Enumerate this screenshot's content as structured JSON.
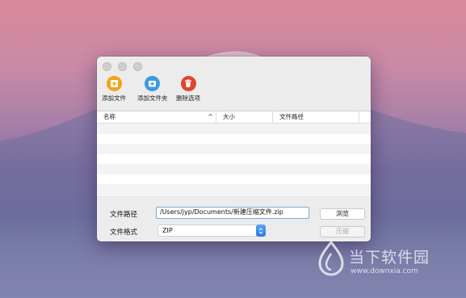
{
  "toolbar": {
    "add_file_label": "添加文件",
    "add_folder_label": "添加文件夹",
    "delete_label": "删除选项"
  },
  "table": {
    "columns": [
      "名称",
      "大小",
      "文件路径"
    ],
    "sort_indicator": "^"
  },
  "form": {
    "path_label": "文件路径",
    "path_value": "/Users/jyp/Documents/新建压缩文件.zip",
    "format_label": "文件格式",
    "format_value": "ZIP",
    "browse_label": "浏览",
    "compress_label": "压缩"
  },
  "watermark": {
    "name": "当下软件园",
    "url": "www.downxia.com"
  },
  "colors": {
    "add_file_icon": "#f3a21a",
    "add_folder_icon": "#3a9be0",
    "delete_icon": "#e0452e",
    "select_accent": "#2a79e6"
  }
}
